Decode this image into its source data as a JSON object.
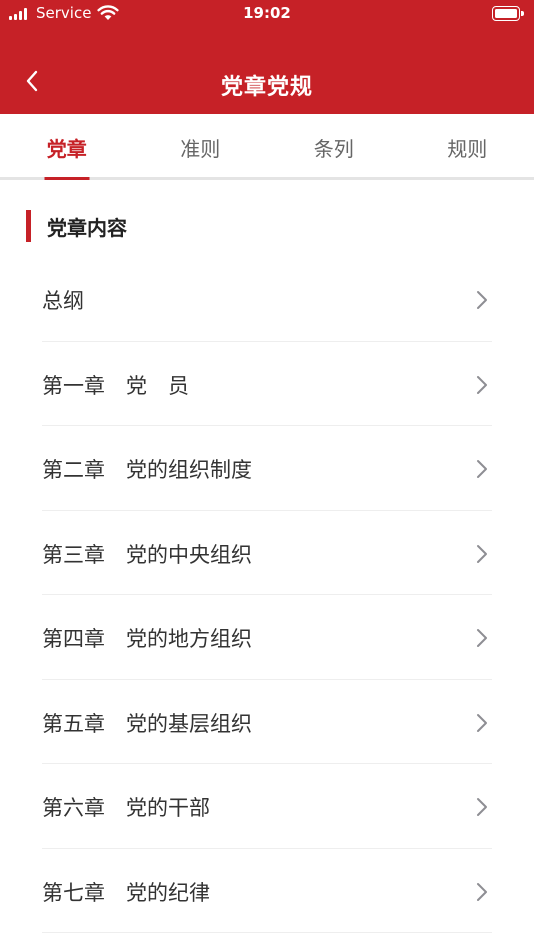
{
  "status_bar": {
    "carrier": "Service",
    "time": "19:02"
  },
  "nav": {
    "title": "党章党规",
    "back_icon": "chevron-left-icon"
  },
  "tabs": [
    {
      "label": "党章",
      "active": true
    },
    {
      "label": "准则",
      "active": false
    },
    {
      "label": "条列",
      "active": false
    },
    {
      "label": "规则",
      "active": false
    }
  ],
  "section": {
    "title": "党章内容"
  },
  "items": [
    {
      "label": "总纲"
    },
    {
      "label": "第一章　党　员"
    },
    {
      "label": "第二章　党的组织制度"
    },
    {
      "label": "第三章　党的中央组织"
    },
    {
      "label": "第四章　党的地方组织"
    },
    {
      "label": "第五章　党的基层组织"
    },
    {
      "label": "第六章　党的干部"
    },
    {
      "label": "第七章　党的纪律"
    }
  ],
  "colors": {
    "primary": "#c62127",
    "text": "#333333",
    "tab_inactive": "#666666",
    "divider": "#eeeeee"
  }
}
